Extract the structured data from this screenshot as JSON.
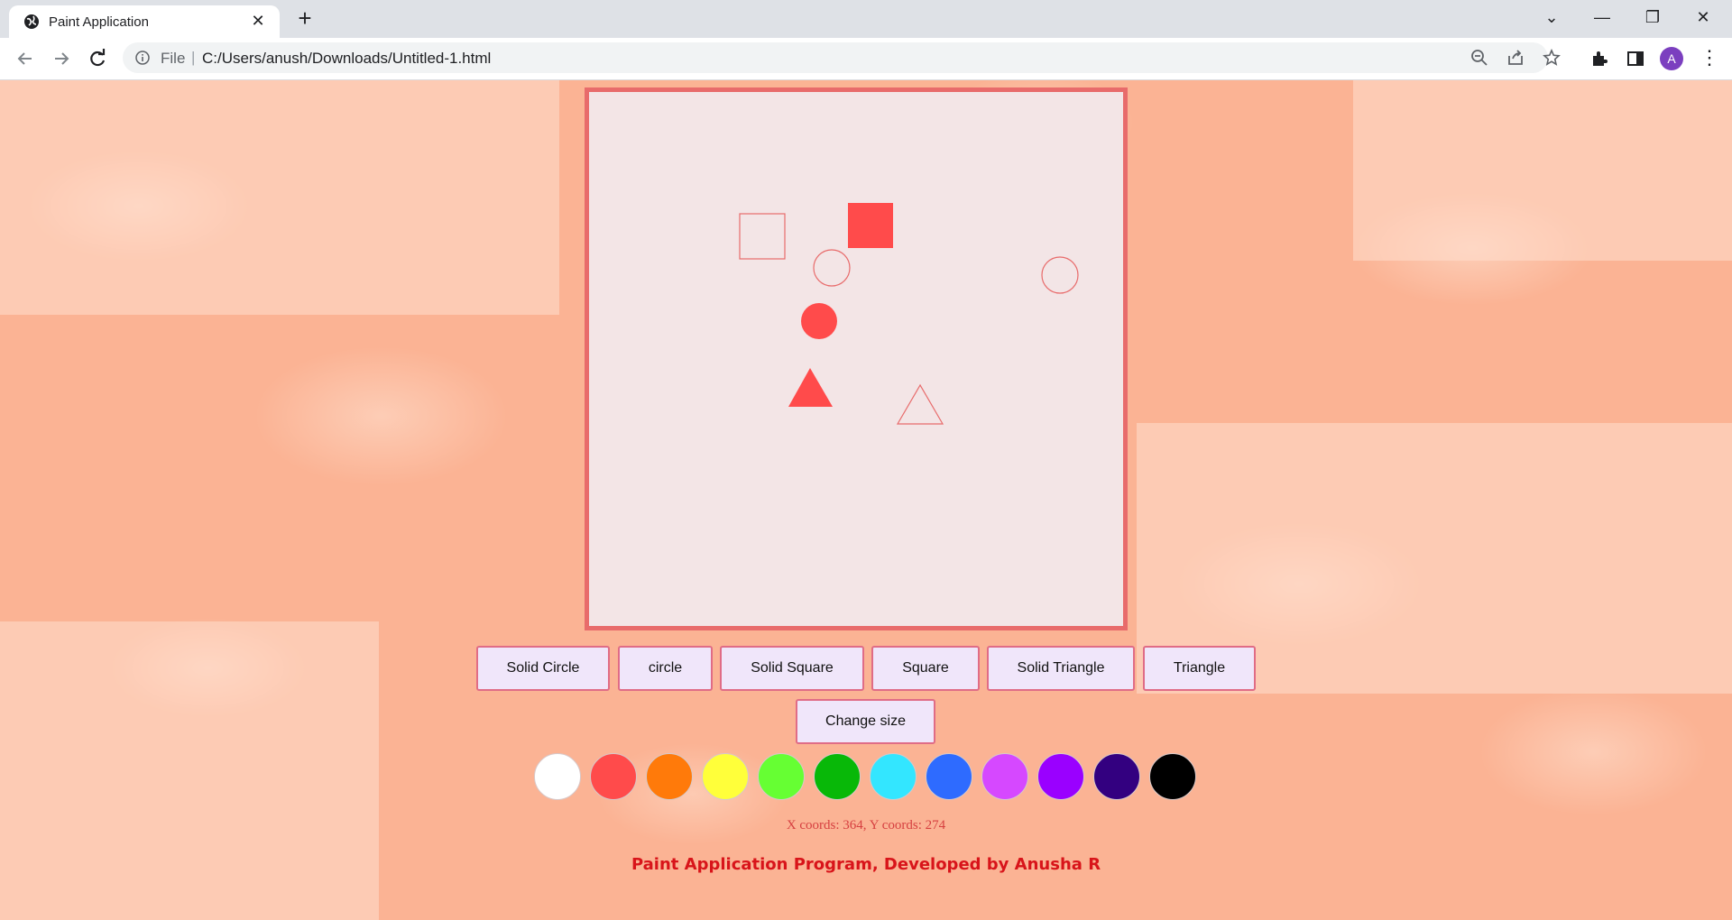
{
  "browser": {
    "tab_title": "Paint Application",
    "tab_close": "✕",
    "new_tab": "+",
    "scheme": "File",
    "separator": "|",
    "url": "C:/Users/anush/Downloads/Untitled-1.html",
    "avatar_letter": "A",
    "window_controls": {
      "chevron": "⌄",
      "minimize": "—",
      "restore": "❐",
      "close": "✕"
    }
  },
  "canvas": {
    "border_color": "#e86b6b",
    "background": "#f3e5e6",
    "shape_color": "#ff4b4b",
    "shapes": [
      {
        "type": "square",
        "filled": false
      },
      {
        "type": "square",
        "filled": true
      },
      {
        "type": "circle",
        "filled": false
      },
      {
        "type": "circle",
        "filled": false
      },
      {
        "type": "circle",
        "filled": true
      },
      {
        "type": "triangle",
        "filled": true
      },
      {
        "type": "triangle",
        "filled": false
      }
    ]
  },
  "buttons": {
    "solid_circle": "Solid Circle",
    "circle": "circle",
    "solid_square": "Solid Square",
    "square": "Square",
    "solid_triangle": "Solid Triangle",
    "triangle": "Triangle",
    "change_size": "Change size"
  },
  "palette": [
    {
      "name": "white",
      "color": "#ffffff"
    },
    {
      "name": "red",
      "color": "#ff4b4b"
    },
    {
      "name": "orange",
      "color": "#ff7a0a"
    },
    {
      "name": "yellow",
      "color": "#ffff3a"
    },
    {
      "name": "light-green",
      "color": "#66ff33"
    },
    {
      "name": "green",
      "color": "#08b808"
    },
    {
      "name": "cyan",
      "color": "#33e6ff"
    },
    {
      "name": "blue",
      "color": "#2e6bff"
    },
    {
      "name": "magenta",
      "color": "#d648ff"
    },
    {
      "name": "purple",
      "color": "#9a00ff"
    },
    {
      "name": "indigo",
      "color": "#330080"
    },
    {
      "name": "black",
      "color": "#000000"
    }
  ],
  "status": {
    "coords_text": "X coords: 364, Y coords: 274"
  },
  "footer": {
    "text": "Paint Application Program, Developed by Anusha R"
  }
}
